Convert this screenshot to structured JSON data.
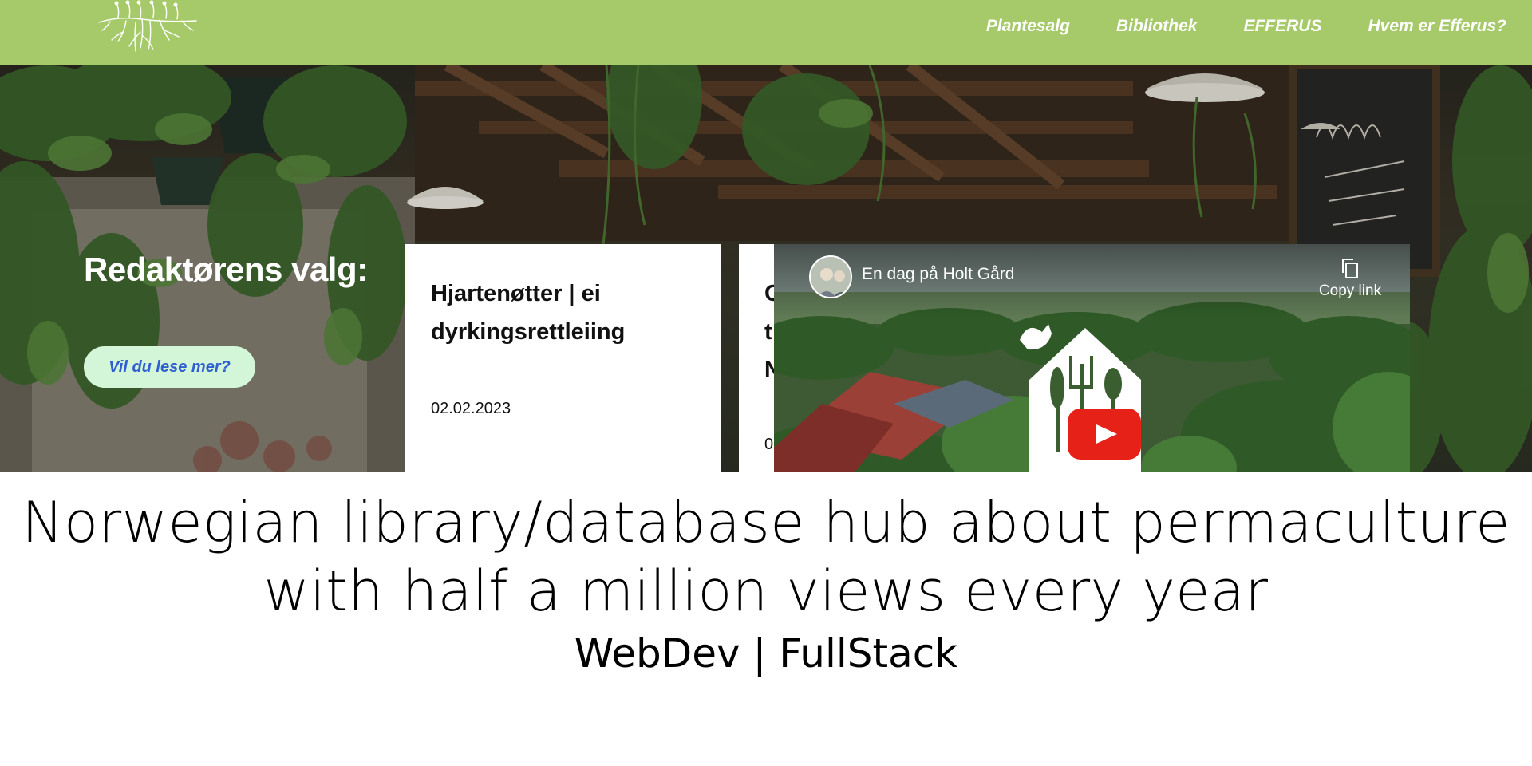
{
  "nav": {
    "links": [
      "Plantesalg",
      "Bibliothek",
      "EFFERUS",
      "Hvem er Efferus?"
    ]
  },
  "hero": {
    "section_title": "Redaktørens valg:",
    "read_more_label": "Vil du lese mer?",
    "cards": [
      {
        "title": "Hjartenøtter | ei dyrkingsrettleiing",
        "date": "02.02.2023"
      },
      {
        "title": "C\nt\nN",
        "date": "0"
      }
    ]
  },
  "video": {
    "title": "En dag på Holt Gård",
    "copy_label": "Copy link"
  },
  "caption": {
    "title_line1": "Norwegian library/database hub about permaculture",
    "title_line2": "with half a million views every year",
    "subtitle": "WebDev | FullStack"
  },
  "colors": {
    "nav_bg": "#a6c96a",
    "button_bg": "#d4f6d8",
    "button_text": "#2f5fd0",
    "youtube_red": "#ff0000"
  },
  "icons": [
    "efferus-logo",
    "copy-icon",
    "youtube-play-icon"
  ]
}
